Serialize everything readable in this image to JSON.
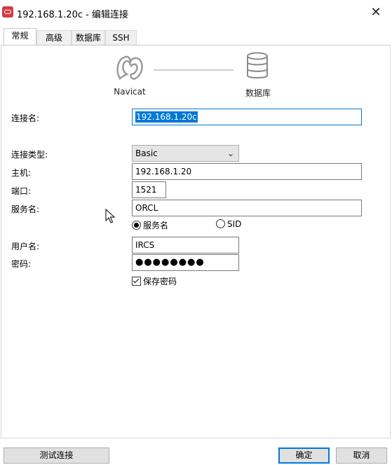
{
  "window": {
    "title": "192.168.1.20c - 编辑连接",
    "close_glyph": "✕"
  },
  "tabs": [
    {
      "label": "常规",
      "active": true
    },
    {
      "label": "高级",
      "active": false
    },
    {
      "label": "数据库",
      "active": false
    },
    {
      "label": "SSH",
      "active": false
    }
  ],
  "header": {
    "navicat_label": "Navicat",
    "database_label": "数据库"
  },
  "form": {
    "connection_name": {
      "label": "连接名:",
      "value": "192.168.1.20c"
    },
    "connection_type": {
      "label": "连接类型:",
      "value": "Basic"
    },
    "host": {
      "label": "主机:",
      "value": "192.168.1.20"
    },
    "port": {
      "label": "端口:",
      "value": "1521"
    },
    "service_name": {
      "label": "服务名:",
      "value": "ORCL"
    },
    "service_type_options": [
      {
        "label": "服务名",
        "selected": true
      },
      {
        "label": "SID",
        "selected": false
      }
    ],
    "username": {
      "label": "用户名:",
      "value": "IRCS"
    },
    "password": {
      "label": "密码:",
      "value": "●●●●●●●●"
    },
    "save_password": {
      "label": "保存密码",
      "checked": true
    }
  },
  "buttons": {
    "test_connection": "测试连接",
    "ok": "确定",
    "cancel": "取消"
  },
  "colors": {
    "accent": "#0078d7",
    "app_icon": "#d43b44"
  }
}
